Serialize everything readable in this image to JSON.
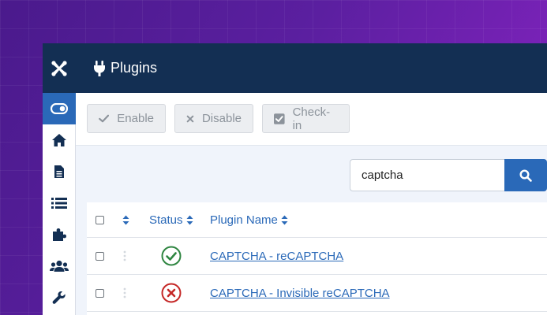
{
  "header": {
    "title": "Plugins",
    "logo_icon": "joomla-logo-icon",
    "title_icon": "plug-icon"
  },
  "sidebar": {
    "items": [
      {
        "icon": "toggle-icon",
        "active": true
      },
      {
        "icon": "home-icon",
        "active": false
      },
      {
        "icon": "file-icon",
        "active": false
      },
      {
        "icon": "list-icon",
        "active": false
      },
      {
        "icon": "puzzle-icon",
        "active": false
      },
      {
        "icon": "users-icon",
        "active": false
      },
      {
        "icon": "wrench-icon",
        "active": false
      }
    ]
  },
  "toolbar": {
    "enable_label": "Enable",
    "disable_label": "Disable",
    "checkin_label": "Check-in"
  },
  "search": {
    "value": "captcha"
  },
  "table": {
    "headers": {
      "status": "Status",
      "plugin_name": "Plugin Name"
    },
    "rows": [
      {
        "name": "CAPTCHA - reCAPTCHA",
        "status": "enabled"
      },
      {
        "name": "CAPTCHA - Invisible reCAPTCHA",
        "status": "disabled"
      }
    ]
  },
  "colors": {
    "header_bg": "#132f53",
    "accent": "#2a69b8",
    "success": "#2e8540",
    "danger": "#c52827"
  }
}
